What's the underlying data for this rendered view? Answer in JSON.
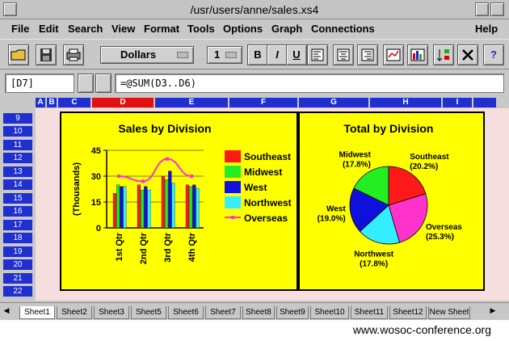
{
  "window": {
    "title": "/usr/users/anne/sales.xs4"
  },
  "menu": [
    "File",
    "Edit",
    "Search",
    "View",
    "Format",
    "Tools",
    "Options",
    "Graph",
    "Connections",
    "Help"
  ],
  "toolbar": {
    "currency": "Dollars",
    "size": "1",
    "bold": "B",
    "italic": "I",
    "underline": "U",
    "help": "?"
  },
  "formula": {
    "cell_ref": "[D7]",
    "expression": "=@SUM(D3..D6)"
  },
  "columns": [
    "A",
    "B",
    "C",
    "D",
    "E",
    "F",
    "G",
    "H",
    "I"
  ],
  "rows": [
    "9",
    "10",
    "11",
    "12",
    "13",
    "14",
    "15",
    "16",
    "17",
    "18",
    "19",
    "20",
    "21",
    "22"
  ],
  "tabs": [
    "Sheet1",
    "Sheet2",
    "Sheet3",
    "Sheet5",
    "Sheet6",
    "Sheet7",
    "Sheet8",
    "Sheet9",
    "Sheet10",
    "Sheet11",
    "Sheet12",
    "New Sheet"
  ],
  "footer": {
    "url": "www.wosoc-conference.org"
  },
  "colors": {
    "southeast": "#ff1a1a",
    "midwest": "#22ee22",
    "west": "#1010dd",
    "northwest": "#33eeff",
    "overseas": "#ff33cc",
    "chart_bg": "#ffff00",
    "header_blue": "#1f2fd0",
    "active_col": "#e01010"
  },
  "chart_data": [
    {
      "type": "bar",
      "title": "Sales by Division",
      "ylabel": "(Thousands)",
      "xlabel": "",
      "categories": [
        "1st Qtr",
        "2nd Qtr",
        "3rd Qtr",
        "4th Qtr"
      ],
      "ylim": [
        0,
        45
      ],
      "yticks": [
        "0",
        "15",
        "30",
        "45"
      ],
      "grid": true,
      "legend": "right",
      "series": [
        {
          "name": "Southeast",
          "values": [
            20,
            25,
            30,
            25
          ]
        },
        {
          "name": "Midwest",
          "values": [
            25,
            22,
            28,
            24
          ]
        },
        {
          "name": "West",
          "values": [
            24,
            24,
            33,
            25
          ]
        },
        {
          "name": "Northwest",
          "values": [
            24,
            22,
            26,
            23
          ]
        },
        {
          "name": "Overseas",
          "type": "line",
          "values": [
            30,
            27,
            40,
            30
          ]
        }
      ]
    },
    {
      "type": "pie",
      "title": "Total by Division",
      "slices": [
        {
          "name": "Southeast",
          "value": 20.2,
          "label": "Southeast",
          "pct": "(20.2%)"
        },
        {
          "name": "Overseas",
          "value": 25.3,
          "label": "Overseas",
          "pct": "(25.3%)"
        },
        {
          "name": "Northwest",
          "value": 17.8,
          "label": "Northwest",
          "pct": "(17.8%)"
        },
        {
          "name": "West",
          "value": 19.0,
          "label": "West",
          "pct": "(19.0%)"
        },
        {
          "name": "Midwest",
          "value": 17.8,
          "label": "Midwest",
          "pct": "(17.8%)"
        }
      ]
    }
  ]
}
